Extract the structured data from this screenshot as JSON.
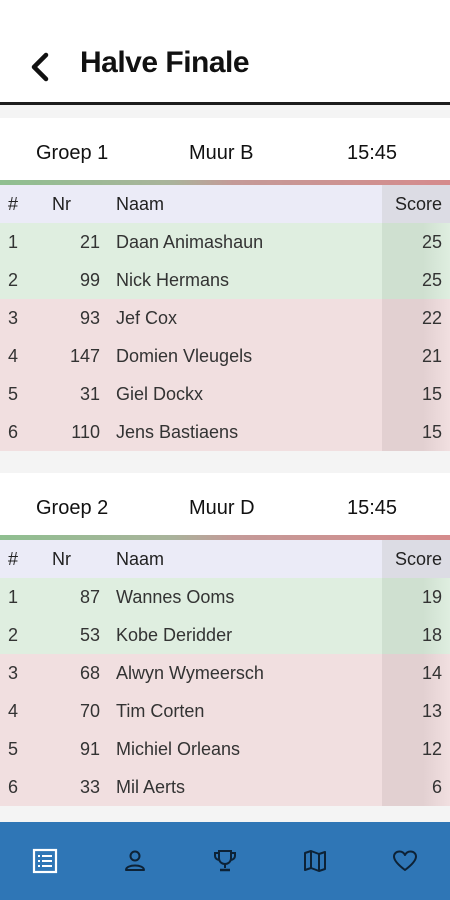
{
  "header": {
    "title": "Halve Finale",
    "back_icon": "back-arrow-icon"
  },
  "table_columns": {
    "rank": "#",
    "nr": "Nr",
    "name": "Naam",
    "score": "Score"
  },
  "groups": [
    {
      "name": "Groep 1",
      "wall": "Muur B",
      "time": "15:45",
      "rows": [
        {
          "rank": "1",
          "nr": "21",
          "name": "Daan Animashaun",
          "score": "25",
          "status": "qualified"
        },
        {
          "rank": "2",
          "nr": "99",
          "name": "Nick Hermans",
          "score": "25",
          "status": "qualified"
        },
        {
          "rank": "3",
          "nr": "93",
          "name": "Jef Cox",
          "score": "22",
          "status": "eliminated"
        },
        {
          "rank": "4",
          "nr": "147",
          "name": "Domien Vleugels",
          "score": "21",
          "status": "eliminated"
        },
        {
          "rank": "5",
          "nr": "31",
          "name": "Giel Dockx",
          "score": "15",
          "status": "eliminated"
        },
        {
          "rank": "6",
          "nr": "110",
          "name": "Jens Bastiaens",
          "score": "15",
          "status": "eliminated"
        }
      ]
    },
    {
      "name": "Groep 2",
      "wall": "Muur D",
      "time": "15:45",
      "rows": [
        {
          "rank": "1",
          "nr": "87",
          "name": "Wannes Ooms",
          "score": "19",
          "status": "qualified"
        },
        {
          "rank": "2",
          "nr": "53",
          "name": "Kobe Deridder",
          "score": "18",
          "status": "qualified"
        },
        {
          "rank": "3",
          "nr": "68",
          "name": "Alwyn Wymeersch",
          "score": "14",
          "status": "eliminated"
        },
        {
          "rank": "4",
          "nr": "70",
          "name": "Tim Corten",
          "score": "13",
          "status": "eliminated"
        },
        {
          "rank": "5",
          "nr": "91",
          "name": "Michiel Orleans",
          "score": "12",
          "status": "eliminated"
        },
        {
          "rank": "6",
          "nr": "33",
          "name": "Mil Aerts",
          "score": "6",
          "status": "eliminated"
        }
      ]
    }
  ],
  "bottom_nav": [
    {
      "icon": "list-icon",
      "active": true
    },
    {
      "icon": "person-icon",
      "active": false
    },
    {
      "icon": "trophy-icon",
      "active": false
    },
    {
      "icon": "map-icon",
      "active": false
    },
    {
      "icon": "heart-icon",
      "active": false
    }
  ],
  "colors": {
    "nav_background": "#2f76b6",
    "qualified_row": "#dfeee0",
    "eliminated_row": "#f1dfe0",
    "column_header": "#ebebf7"
  }
}
